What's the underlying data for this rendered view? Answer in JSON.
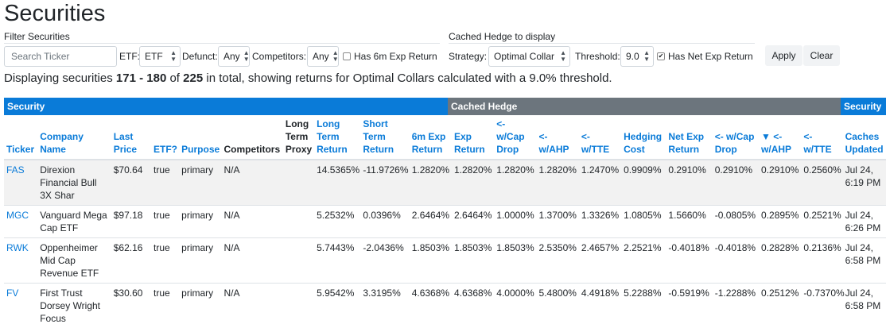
{
  "page": {
    "title": "Securities"
  },
  "filter": {
    "section_label": "Filter Securities",
    "search_placeholder": "Search Ticker",
    "etf_label": "ETF:",
    "etf_value": "ETF",
    "defunct_label": "Defunct:",
    "defunct_value": "Any",
    "competitors_label": "Competitors:",
    "competitors_value": "Any",
    "has6m_label": "Has 6m Exp Return",
    "has6m_checked": false
  },
  "hedge": {
    "section_label": "Cached Hedge to display",
    "strategy_label": "Strategy:",
    "strategy_value": "Optimal Collar",
    "threshold_label": "Threshold:",
    "threshold_value": "9.0",
    "has_net_label": "Has Net Exp Return",
    "has_net_checked": true,
    "apply_label": "Apply",
    "clear_label": "Clear"
  },
  "summary": {
    "prefix": "Displaying securities",
    "range": "171 - 180",
    "of": "of",
    "total": "225",
    "suffix": "in total, showing returns for Optimal Collars calculated with a 9.0% threshold."
  },
  "bands": {
    "security": "Security",
    "cached_hedge": "Cached Hedge",
    "security_right": "Security",
    "colors": {
      "security": "#0a7bd8",
      "cached_hedge": "#6c757d"
    }
  },
  "columns": [
    {
      "label": "Ticker",
      "link": true
    },
    {
      "label": "Company Name",
      "link": true
    },
    {
      "label": "Last Price",
      "link": true
    },
    {
      "label": "ETF?",
      "link": true
    },
    {
      "label": "Purpose",
      "link": true
    },
    {
      "label": "Competitors",
      "link": false
    },
    {
      "label": "Long Term Proxy",
      "link": false
    },
    {
      "label": "Long Term Return",
      "link": true
    },
    {
      "label": "Short Term Return",
      "link": true
    },
    {
      "label": "6m Exp Return",
      "link": true
    },
    {
      "label": "Exp Return",
      "link": true
    },
    {
      "label": "<- w/Cap Drop",
      "link": true
    },
    {
      "label": "<- w/AHP",
      "link": true
    },
    {
      "label": "<- w/TTE",
      "link": true
    },
    {
      "label": "Hedging Cost",
      "link": true
    },
    {
      "label": "Net Exp Return",
      "link": true
    },
    {
      "label": "<- w/Cap Drop",
      "link": true
    },
    {
      "label": "▼ <- w/AHP",
      "link": true
    },
    {
      "label": "<- w/TTE",
      "link": true
    },
    {
      "label": "Caches Updated",
      "link": true
    }
  ],
  "rows": [
    {
      "highlight": true,
      "cells": [
        "FAS",
        "Direxion Financial Bull 3X Shar",
        "$70.64",
        "true",
        "primary",
        "N/A",
        "",
        "14.5365%",
        "-11.9726%",
        "1.2820%",
        "1.2820%",
        "1.2820%",
        "1.2820%",
        "1.2470%",
        "0.9909%",
        "0.2910%",
        "0.2910%",
        "0.2910%",
        "0.2560%",
        "Jul 24, 6:19 PM"
      ]
    },
    {
      "highlight": false,
      "cells": [
        "MGC",
        "Vanguard Mega Cap ETF",
        "$97.18",
        "true",
        "primary",
        "N/A",
        "",
        "5.2532%",
        "0.0396%",
        "2.6464%",
        "2.6464%",
        "1.0000%",
        "1.3700%",
        "1.3326%",
        "1.0805%",
        "1.5660%",
        "-0.0805%",
        "0.2895%",
        "0.2521%",
        "Jul 24, 6:26 PM"
      ]
    },
    {
      "highlight": false,
      "cells": [
        "RWK",
        "Oppenheimer Mid Cap Revenue ETF",
        "$62.16",
        "true",
        "primary",
        "N/A",
        "",
        "5.7443%",
        "-2.0436%",
        "1.8503%",
        "1.8503%",
        "1.8503%",
        "2.5350%",
        "2.4657%",
        "2.2521%",
        "-0.4018%",
        "-0.4018%",
        "0.2828%",
        "0.2136%",
        "Jul 24, 6:58 PM"
      ]
    },
    {
      "highlight": false,
      "cells": [
        "FV",
        "First Trust Dorsey Wright Focus",
        "$30.60",
        "true",
        "primary",
        "N/A",
        "",
        "5.9542%",
        "3.3195%",
        "4.6368%",
        "4.6368%",
        "4.0000%",
        "5.4800%",
        "4.4918%",
        "5.2288%",
        "-0.5919%",
        "-1.2288%",
        "0.2512%",
        "-0.7370%",
        "Jul 24, 6:58 PM"
      ]
    }
  ]
}
